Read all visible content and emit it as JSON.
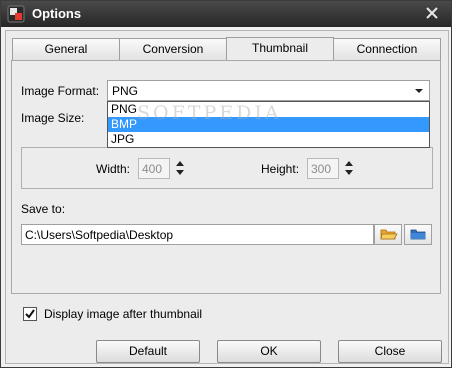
{
  "window": {
    "title": "Options"
  },
  "tabs": [
    {
      "label": "General",
      "active": false
    },
    {
      "label": "Conversion",
      "active": false
    },
    {
      "label": "Thumbnail",
      "active": true
    },
    {
      "label": "Connection",
      "active": false
    }
  ],
  "image_format": {
    "label": "Image Format:",
    "value": "PNG",
    "options": [
      "PNG",
      "BMP",
      "JPG"
    ],
    "highlighted": "BMP"
  },
  "image_size": {
    "label": "Image Size:",
    "width_label": "Width:",
    "width_value": "400",
    "height_label": "Height:",
    "height_value": "300"
  },
  "save_to": {
    "label": "Save to:",
    "path": "C:\\Users\\Softpedia\\Desktop"
  },
  "display_after": {
    "label": "Display image after thumbnail",
    "checked": true
  },
  "buttons": {
    "default": "Default",
    "ok": "OK",
    "close": "Close"
  },
  "watermark": {
    "text": "SOFTPEDIA",
    "url": "www.softpedia.com"
  },
  "colors": {
    "selection": "#3399ff",
    "titlebar": "#2e2e2e",
    "folder": "#f2b23a"
  }
}
